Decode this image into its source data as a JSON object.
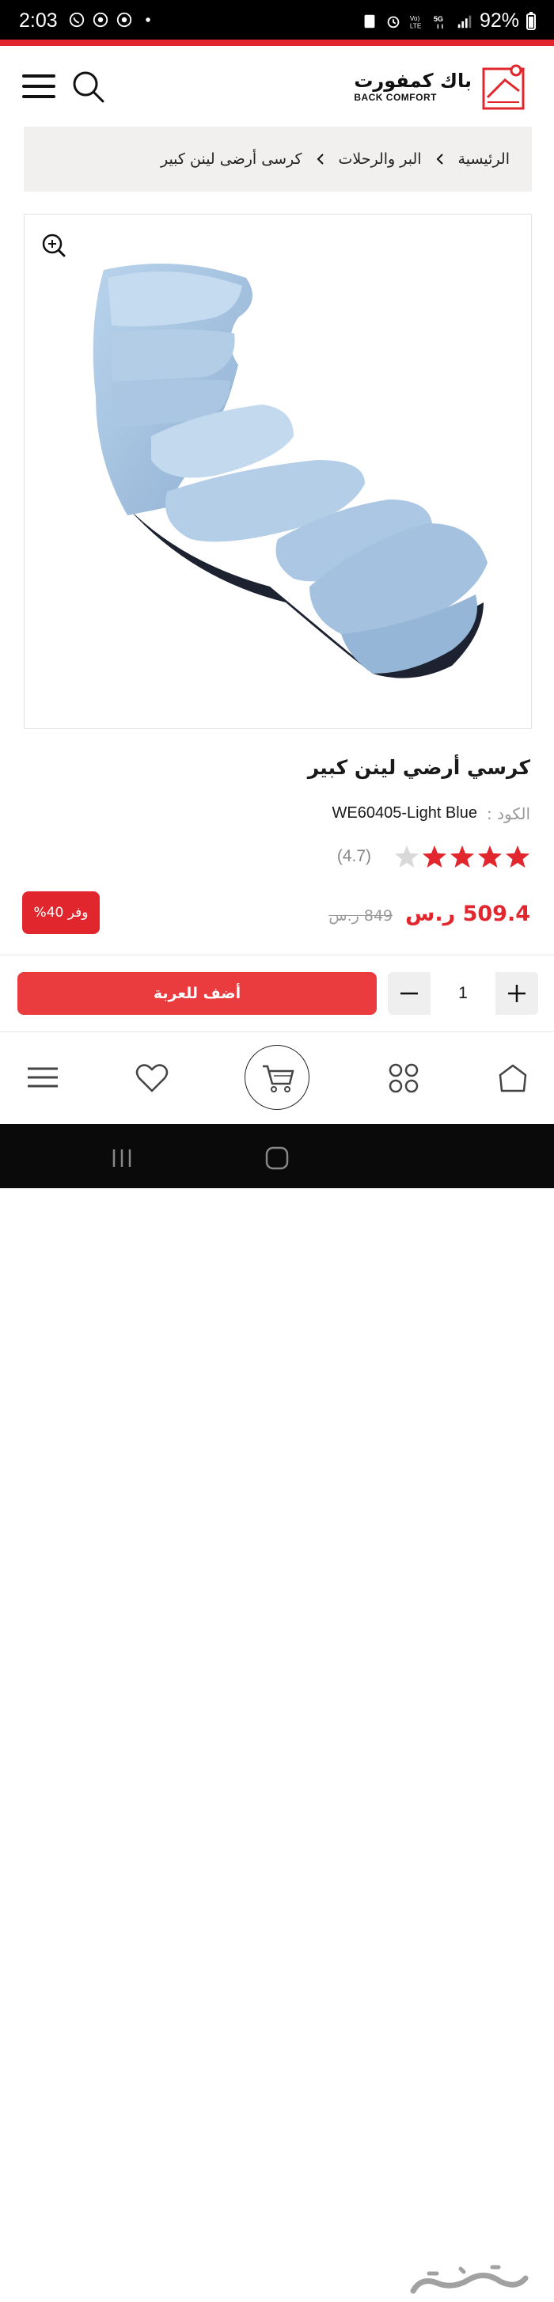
{
  "status_bar": {
    "time": "2:03",
    "battery": "92%"
  },
  "header": {
    "logo_ar": "باك كمفورت",
    "logo_en": "BACK COMFORT"
  },
  "breadcrumb": {
    "items": [
      "الرئيسية",
      "البر والرحلات",
      "كرسى أرضى لينن كبير"
    ]
  },
  "product": {
    "title": "كرسي أرضي لينن كبير",
    "code_label": "الكود :",
    "code_value": "WE60405-Light Blue",
    "rating": 4.7,
    "rating_text": "(4.7)",
    "rating_stars_filled": 4,
    "rating_stars_total": 5,
    "price_now": "509.4 ر.س",
    "price_old": "849 ر.س",
    "discount": "وفر 40%",
    "image_color": "#a9c6e2"
  },
  "cart": {
    "add_label": "أضف للعربة",
    "quantity": "1"
  },
  "bottom_nav": {
    "items": [
      "menu-icon",
      "heart-icon",
      "cart-icon",
      "categories-icon",
      "home-icon"
    ]
  },
  "watermark": "حراج",
  "colors": {
    "accent": "#e1262d",
    "button": "#ea3b3f",
    "star": "#e1262d"
  }
}
